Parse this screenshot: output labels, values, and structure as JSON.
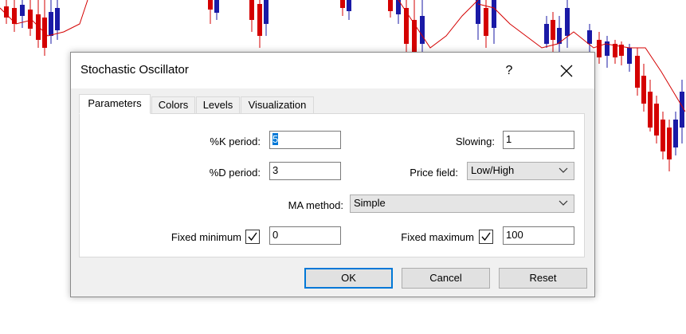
{
  "dialog": {
    "title": "Stochastic Oscillator",
    "help": "?"
  },
  "tabs": [
    {
      "label": "Parameters",
      "active": true
    },
    {
      "label": "Colors",
      "active": false
    },
    {
      "label": "Levels",
      "active": false
    },
    {
      "label": "Visualization",
      "active": false
    }
  ],
  "params": {
    "k_period_label": "%K period:",
    "k_period_value": "5",
    "d_period_label": "%D period:",
    "d_period_value": "3",
    "slowing_label": "Slowing:",
    "slowing_value": "1",
    "price_field_label": "Price field:",
    "price_field_value": "Low/High",
    "ma_method_label": "MA method:",
    "ma_method_value": "Simple",
    "fixed_min_label": "Fixed minimum",
    "fixed_min_checked": true,
    "fixed_min_value": "0",
    "fixed_max_label": "Fixed maximum",
    "fixed_max_checked": true,
    "fixed_max_value": "100"
  },
  "buttons": {
    "ok": "OK",
    "cancel": "Cancel",
    "reset": "Reset"
  },
  "colors": {
    "bull_candle": "#1a1aa6",
    "bear_candle": "#d40000",
    "ma_line": "#d40000",
    "accent": "#0078d7"
  }
}
